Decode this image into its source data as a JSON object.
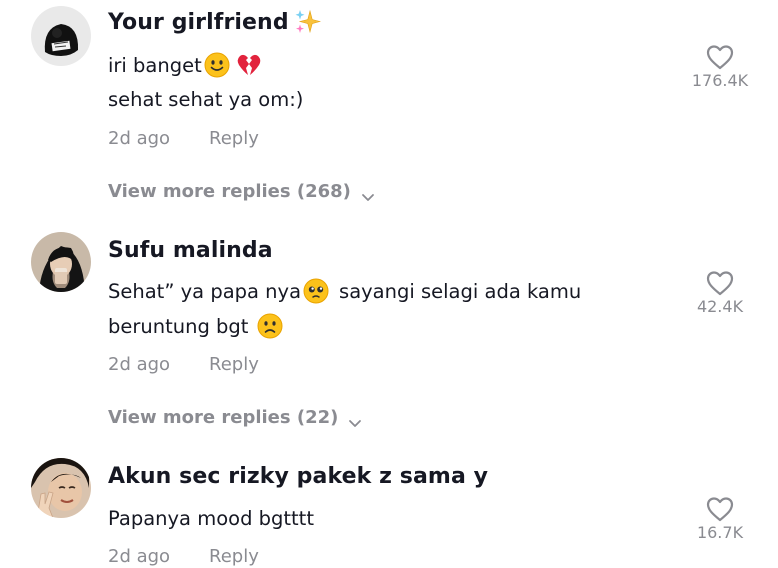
{
  "comments": [
    {
      "username": "Your girlfriend",
      "username_emoji": "sparkles-icon",
      "lines": [
        {
          "text": "iri banget",
          "emojis": [
            "slightly-smiling-face-icon",
            "broken-heart-icon"
          ]
        },
        {
          "text": "sehat sehat ya om:)",
          "emojis": []
        }
      ],
      "time": "2d ago",
      "reply_label": "Reply",
      "likes": "176.4K",
      "view_more": "View more replies (268)"
    },
    {
      "username": "Sufu malinda",
      "lines": [
        {
          "text": "Sehat” ya papa nya",
          "after_emoji": "sayangi selagi ada kamu",
          "emojis": [
            "pleading-face-icon"
          ]
        },
        {
          "text": "beruntung bgt ",
          "emojis": [
            "slightly-frowning-face-icon"
          ]
        }
      ],
      "time": "2d ago",
      "reply_label": "Reply",
      "likes": "42.4K",
      "view_more": "View more replies (22)"
    },
    {
      "username": "Akun sec rizky pakek z sama y",
      "lines": [
        {
          "text": "Papanya mood bgtttt",
          "emojis": []
        }
      ],
      "time": "2d ago",
      "reply_label": "Reply",
      "likes": "16.7K"
    }
  ],
  "colors": {
    "primary_text": "#161823",
    "secondary_text": "#8a8b91",
    "heart_outline": "#8a8b91"
  }
}
